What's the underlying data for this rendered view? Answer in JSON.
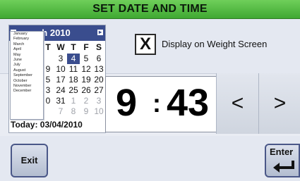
{
  "title": "SET DATE AND TIME",
  "calendar": {
    "month_label": "March 2010",
    "month_label_visible": "rch 2010",
    "dow_visible": [
      "T",
      "W",
      "T",
      "F",
      "S"
    ],
    "rows": [
      [
        "3",
        "4",
        "5",
        "6"
      ],
      [
        "9",
        "10",
        "11",
        "12",
        "13"
      ],
      [
        "5",
        "17",
        "18",
        "19",
        "20"
      ],
      [
        "3",
        "24",
        "25",
        "26",
        "27"
      ],
      [
        "0",
        "31",
        "1",
        "2",
        "3"
      ],
      [
        "7",
        "8",
        "9",
        "10"
      ]
    ],
    "selected_day": "4",
    "today_label": "Today: 03/04/2010"
  },
  "month_menu": {
    "items": [
      "January",
      "February",
      "March",
      "April",
      "May",
      "June",
      "July",
      "August",
      "September",
      "October",
      "November",
      "December"
    ],
    "selected": "March"
  },
  "weight_checkbox": {
    "mark": "X",
    "label": "Display on Weight Screen"
  },
  "time": {
    "hour": "9",
    "separator": ":",
    "minute": "43"
  },
  "buttons": {
    "prev": "<",
    "next": ">",
    "exit": "Exit",
    "enter": "Enter"
  },
  "colors": {
    "title_bar": "#4dbb3a",
    "calendar_header": "#3a4d8e",
    "button_border": "#4a5788"
  }
}
